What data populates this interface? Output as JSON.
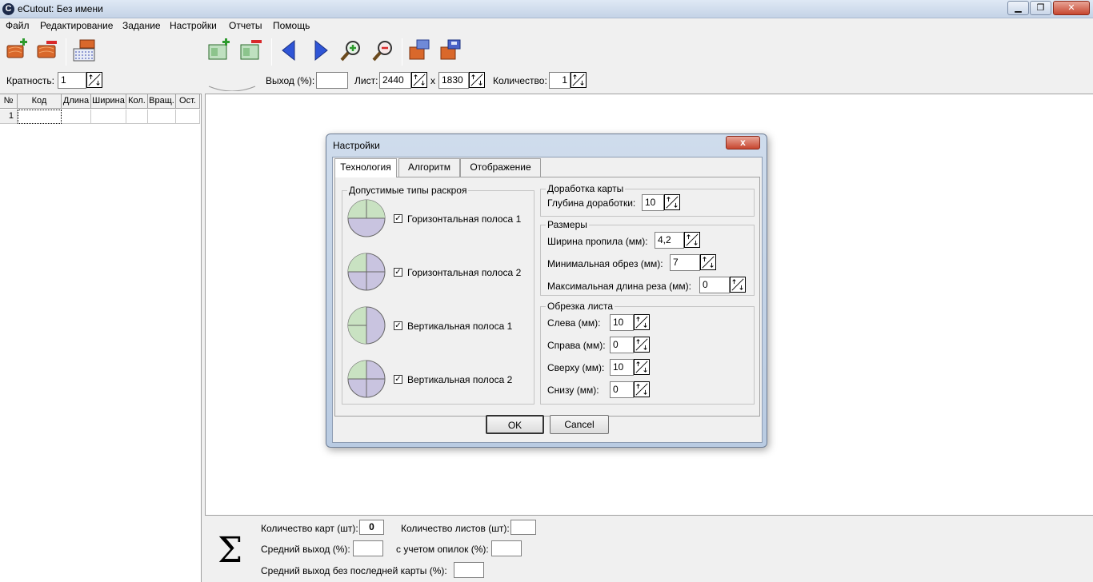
{
  "window": {
    "title": "eCutout: Без имени",
    "app_icon_letter": "C",
    "minimize": "▁",
    "maximize": "❐",
    "close": "✕"
  },
  "menu": {
    "items": [
      "Файл",
      "Редактирование",
      "Задание",
      "Настройки",
      "Отчеты",
      "Помощь"
    ]
  },
  "toolbar": {
    "icons": [
      "add-part-icon",
      "remove-part-icon",
      "parts-list-icon",
      "add-sheet-icon",
      "remove-sheet-icon",
      "prev-icon",
      "next-icon",
      "zoom-in-icon",
      "zoom-out-icon",
      "open-icon",
      "save-icon"
    ]
  },
  "params": {
    "multiplicity_label": "Кратность:",
    "multiplicity_value": "1",
    "yield_label": "Выход (%):",
    "yield_value": "",
    "sheet_label": "Лист:",
    "sheet_width": "2440",
    "times": "x",
    "sheet_height": "1830",
    "quantity_label": "Количество:",
    "quantity_value": "1"
  },
  "grid": {
    "headers": [
      "№",
      "Код",
      "Длина",
      "Ширина",
      "Кол.",
      "Вращ.",
      "Ост."
    ],
    "rows": [
      [
        "1",
        "",
        "",
        "",
        "",
        "",
        ""
      ]
    ]
  },
  "stats": {
    "sigma": "Σ",
    "maps_count_label": "Количество карт (шт):",
    "maps_count_value": "0",
    "sheets_count_label": "Количество листов (шт):",
    "sheets_count_value": "",
    "avg_yield_label": "Средний выход (%):",
    "avg_yield_value": "",
    "with_sawdust_label": "с учетом опилок (%):",
    "with_sawdust_value": "",
    "avg_yield_no_last_label": "Средний выход без последней карты (%):",
    "avg_yield_no_last_value": ""
  },
  "dialog": {
    "title": "Настройки",
    "close": "x",
    "tabs": [
      "Технология",
      "Алгоритм",
      "Отображение"
    ],
    "cut_types": {
      "title": "Допустимые типы раскроя",
      "items": [
        {
          "label": "Горизонтальная полоса 1",
          "checked": true
        },
        {
          "label": "Горизонтальная полоса 2",
          "checked": true
        },
        {
          "label": "Вертикальная полоса 1",
          "checked": true
        },
        {
          "label": "Вертикальная полоса 2",
          "checked": true
        }
      ],
      "check_mark": "✓"
    },
    "refine": {
      "title": "Доработка карты",
      "depth_label": "Глубина доработки:",
      "depth_value": "10"
    },
    "sizes": {
      "title": "Размеры",
      "kerf_label": "Ширина пропила (мм):",
      "kerf_value": "4,2",
      "min_trim_label": "Минимальная обрез (мм):",
      "min_trim_value": "7",
      "max_cut_label": "Максимальная длина реза (мм):",
      "max_cut_value": "0"
    },
    "trim": {
      "title": "Обрезка листа",
      "left_label": "Слева (мм):",
      "left_value": "10",
      "right_label": "Справа (мм):",
      "right_value": "0",
      "top_label": "Сверху (мм):",
      "top_value": "10",
      "bottom_label": "Снизу (мм):",
      "bottom_value": "0"
    },
    "ok": "OK",
    "cancel": "Cancel"
  },
  "colors": {
    "pie_green": "#c9e2c2",
    "pie_purple": "#c9c4e0",
    "nav_blue": "#2f55d6",
    "icon_orange": "#d9682b"
  }
}
